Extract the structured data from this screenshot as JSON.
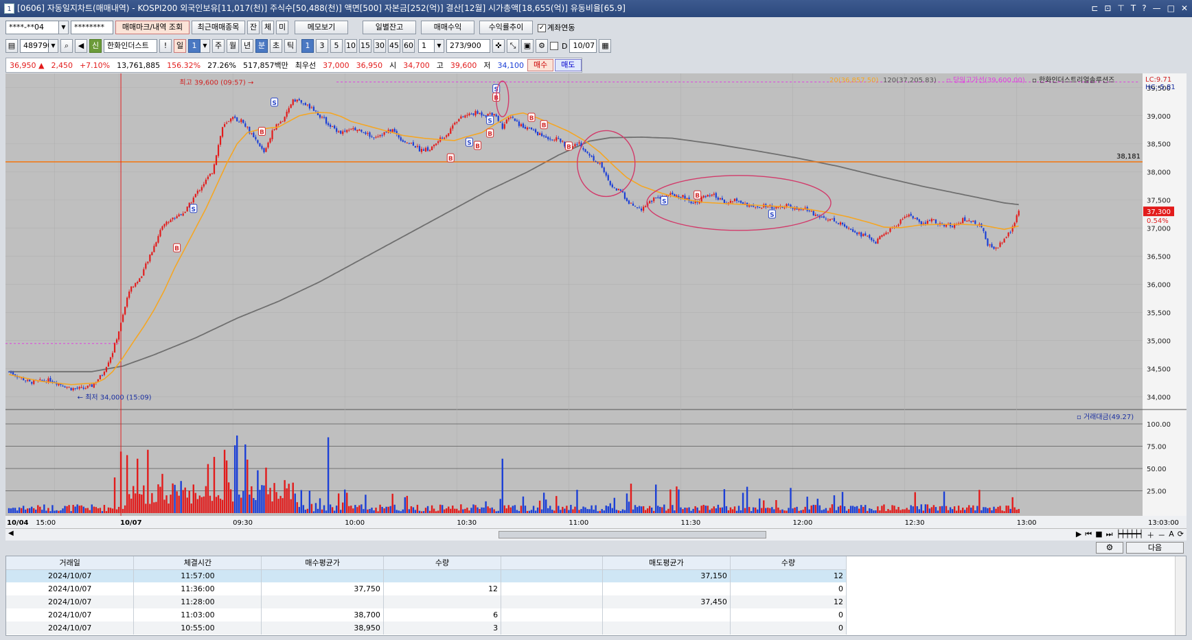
{
  "titlebar": {
    "badge": "1",
    "text": "[0606] 자동일지차트(매매내역) - KOSPI200 외국인보유[11,017(천)] 주식수[50,488(천)] 액면[500] 자본금[252(억)] 결산[12월] 시가총액[18,655(억)] 유동비율[65.9]",
    "controls": [
      "⊏",
      "⊡",
      "⊤",
      "T",
      "?",
      "—",
      "□",
      "✕"
    ]
  },
  "toolbar1": {
    "account": "****-**04",
    "password": "********",
    "btn_trade_mark": "매매마크/내역 조회",
    "btn_recent": "최근매매종목",
    "tab_jan": "잔",
    "tab_che": "체",
    "tab_mi": "미",
    "btn_memo": "메모보기",
    "btn_daily": "일별잔고",
    "btn_profit": "매매수익",
    "btn_rate": "수익률추이",
    "chk_link": "계좌연동"
  },
  "toolbar2": {
    "code": "489790",
    "stock_tag": "신",
    "stock_name": "한화인더스트",
    "excl": "!",
    "period": [
      "일",
      "1",
      "주",
      "월",
      "년",
      "분",
      "초",
      "틱"
    ],
    "minutes": [
      "1",
      "3",
      "5",
      "10",
      "15",
      "30",
      "45",
      "60"
    ],
    "step": "1",
    "count": "273",
    "count_total": "/900",
    "date_label": "D",
    "date": "10/07"
  },
  "quote": {
    "price": "36,950 ▲",
    "change": "2,450",
    "change_pct": "+7.10%",
    "volume": "13,761,885",
    "vol_ratio": "156.32%",
    "turnover": "27.26%",
    "amount": "517,857백만",
    "best_label": "최우선",
    "best_ask": "37,000",
    "best_bid": "36,950",
    "open_label": "시",
    "open": "34,700",
    "high_label": "고",
    "high": "39,600",
    "low_label": "저",
    "low": "34,100",
    "buy": "매수",
    "sell": "매도"
  },
  "chart_data": {
    "type": "candlestick",
    "legend": {
      "ma20": "20(36,857.50)",
      "ma120": "120(37,205.83)",
      "high_line": "당일고가선(39,600.00)",
      "name": "한화인더스트리얼솔루션즈",
      "lc": "LC:9.71",
      "hc": "HC:-5.81"
    },
    "price_axis": [
      "39,500",
      "39,000",
      "38,500",
      "38,000",
      "37,500",
      "37,000",
      "36,500",
      "36,000",
      "35,500",
      "35,000",
      "34,500",
      "34,000"
    ],
    "price_values": [
      39500,
      39000,
      38500,
      38000,
      37500,
      37000,
      36500,
      36000,
      35500,
      35000,
      34500,
      34000
    ],
    "ylim": [
      33850,
      39680
    ],
    "hline_value": 38181,
    "hline_label": "38,181",
    "current_label": "37,300",
    "current_value": 37300,
    "current_pct": "0.54%",
    "annotations": {
      "max": "최고 39,600 (09:57)",
      "min": "최저 34,000 (15:09)"
    },
    "volume_legend": "거래대금(49.27)",
    "volume_axis": [
      "100.00",
      "75.00",
      "50.00",
      "25.00"
    ],
    "volume_values": [
      100,
      75,
      50,
      25
    ],
    "time_axis": [
      "10/04",
      "15:00",
      "10/07",
      "09:30",
      "10:00",
      "10:30",
      "11:00",
      "11:30",
      "12:00",
      "12:30",
      "13:00"
    ],
    "time_end": "13:03:00",
    "anchors_price": [
      [
        0,
        34450
      ],
      [
        10,
        34260
      ],
      [
        20,
        34300
      ],
      [
        30,
        34150
      ],
      [
        36,
        34150
      ],
      [
        40,
        34200
      ],
      [
        45,
        34400
      ],
      [
        50,
        34800
      ],
      [
        54,
        35300
      ],
      [
        58,
        35900
      ],
      [
        63,
        36100
      ],
      [
        68,
        36500
      ],
      [
        74,
        37050
      ],
      [
        80,
        37200
      ],
      [
        85,
        37300
      ],
      [
        90,
        37600
      ],
      [
        98,
        38000
      ],
      [
        103,
        38800
      ],
      [
        108,
        38950
      ],
      [
        113,
        38900
      ],
      [
        118,
        38600
      ],
      [
        123,
        38350
      ],
      [
        128,
        38800
      ],
      [
        133,
        38950
      ],
      [
        137,
        39300
      ],
      [
        141,
        39250
      ],
      [
        146,
        39120
      ],
      [
        150,
        39000
      ],
      [
        155,
        38820
      ],
      [
        160,
        38700
      ],
      [
        165,
        38750
      ],
      [
        170,
        38750
      ],
      [
        175,
        38620
      ],
      [
        180,
        38680
      ],
      [
        185,
        38750
      ],
      [
        190,
        38550
      ],
      [
        195,
        38500
      ],
      [
        198,
        38400
      ],
      [
        203,
        38400
      ],
      [
        207,
        38550
      ],
      [
        212,
        38700
      ],
      [
        215,
        38900
      ],
      [
        220,
        39000
      ],
      [
        225,
        39050
      ],
      [
        230,
        39020
      ],
      [
        234,
        39050
      ],
      [
        238,
        38800
      ],
      [
        242,
        39000
      ],
      [
        246,
        38850
      ],
      [
        252,
        38750
      ],
      [
        258,
        38620
      ],
      [
        265,
        38580
      ],
      [
        270,
        38420
      ],
      [
        275,
        38520
      ],
      [
        280,
        38280
      ],
      [
        285,
        38160
      ],
      [
        290,
        37750
      ],
      [
        295,
        37650
      ],
      [
        300,
        37420
      ],
      [
        305,
        37350
      ],
      [
        310,
        37500
      ],
      [
        315,
        37550
      ],
      [
        320,
        37600
      ],
      [
        325,
        37560
      ],
      [
        330,
        37450
      ],
      [
        335,
        37550
      ],
      [
        340,
        37580
      ],
      [
        345,
        37450
      ],
      [
        350,
        37500
      ],
      [
        355,
        37440
      ],
      [
        360,
        37350
      ],
      [
        365,
        37400
      ],
      [
        370,
        37350
      ],
      [
        375,
        37400
      ],
      [
        380,
        37330
      ],
      [
        385,
        37340
      ],
      [
        390,
        37200
      ],
      [
        395,
        37180
      ],
      [
        400,
        37100
      ],
      [
        405,
        37020
      ],
      [
        410,
        36900
      ],
      [
        414,
        36850
      ],
      [
        418,
        36750
      ],
      [
        422,
        36900
      ],
      [
        428,
        37050
      ],
      [
        433,
        37250
      ],
      [
        436,
        37200
      ],
      [
        440,
        37050
      ],
      [
        445,
        37150
      ],
      [
        450,
        37050
      ],
      [
        455,
        37050
      ],
      [
        460,
        37150
      ],
      [
        465,
        37120
      ],
      [
        469,
        37020
      ],
      [
        472,
        36700
      ],
      [
        476,
        36650
      ],
      [
        480,
        36800
      ],
      [
        484,
        37000
      ],
      [
        487,
        37300
      ]
    ],
    "anchors_ma20": [
      [
        0,
        34400
      ],
      [
        15,
        34280
      ],
      [
        30,
        34220
      ],
      [
        42,
        34250
      ],
      [
        46,
        34320
      ],
      [
        50,
        34450
      ],
      [
        55,
        34700
      ],
      [
        60,
        34980
      ],
      [
        65,
        35250
      ],
      [
        70,
        35550
      ],
      [
        75,
        35900
      ],
      [
        80,
        36300
      ],
      [
        85,
        36650
      ],
      [
        90,
        37000
      ],
      [
        95,
        37350
      ],
      [
        100,
        37750
      ],
      [
        105,
        38150
      ],
      [
        110,
        38500
      ],
      [
        115,
        38700
      ],
      [
        120,
        38750
      ],
      [
        125,
        38780
      ],
      [
        130,
        38800
      ],
      [
        135,
        38900
      ],
      [
        140,
        39000
      ],
      [
        145,
        39040
      ],
      [
        150,
        39060
      ],
      [
        155,
        39050
      ],
      [
        160,
        38990
      ],
      [
        165,
        38900
      ],
      [
        170,
        38850
      ],
      [
        175,
        38800
      ],
      [
        180,
        38750
      ],
      [
        185,
        38700
      ],
      [
        190,
        38650
      ],
      [
        200,
        38600
      ],
      [
        210,
        38570
      ],
      [
        215,
        38560
      ],
      [
        220,
        38620
      ],
      [
        228,
        38700
      ],
      [
        235,
        38860
      ],
      [
        242,
        39010
      ],
      [
        248,
        39050
      ],
      [
        255,
        38960
      ],
      [
        262,
        38850
      ],
      [
        270,
        38720
      ],
      [
        278,
        38550
      ],
      [
        285,
        38350
      ],
      [
        292,
        38100
      ],
      [
        298,
        37900
      ],
      [
        305,
        37750
      ],
      [
        315,
        37620
      ],
      [
        325,
        37520
      ],
      [
        335,
        37460
      ],
      [
        345,
        37440
      ],
      [
        355,
        37420
      ],
      [
        365,
        37400
      ],
      [
        375,
        37380
      ],
      [
        385,
        37340
      ],
      [
        395,
        37280
      ],
      [
        405,
        37200
      ],
      [
        415,
        37100
      ],
      [
        422,
        37020
      ],
      [
        430,
        37010
      ],
      [
        440,
        37060
      ],
      [
        450,
        37070
      ],
      [
        460,
        37070
      ],
      [
        470,
        37050
      ],
      [
        480,
        36980
      ],
      [
        487,
        37040
      ]
    ],
    "anchors_ma120": [
      [
        0,
        34450
      ],
      [
        40,
        34450
      ],
      [
        55,
        34550
      ],
      [
        70,
        34750
      ],
      [
        90,
        35050
      ],
      [
        110,
        35400
      ],
      [
        130,
        35700
      ],
      [
        150,
        36050
      ],
      [
        170,
        36450
      ],
      [
        190,
        36850
      ],
      [
        210,
        37250
      ],
      [
        230,
        37650
      ],
      [
        250,
        38000
      ],
      [
        265,
        38300
      ],
      [
        280,
        38550
      ],
      [
        290,
        38610
      ],
      [
        305,
        38620
      ],
      [
        320,
        38600
      ],
      [
        340,
        38500
      ],
      [
        360,
        38380
      ],
      [
        380,
        38250
      ],
      [
        400,
        38100
      ],
      [
        420,
        37920
      ],
      [
        440,
        37750
      ],
      [
        460,
        37600
      ],
      [
        480,
        37450
      ],
      [
        487,
        37420
      ]
    ],
    "trade_marks": [
      {
        "type": "S",
        "idx": 128,
        "price": 39230
      },
      {
        "type": "B",
        "idx": 122,
        "price": 38710
      },
      {
        "type": "S",
        "idx": 89,
        "price": 37340
      },
      {
        "type": "B",
        "idx": 81,
        "price": 36640
      },
      {
        "type": "S",
        "idx": 235,
        "price": 39470
      },
      {
        "type": "B",
        "idx": 235,
        "price": 39320
      },
      {
        "type": "S",
        "idx": 232,
        "price": 38910
      },
      {
        "type": "B",
        "idx": 232,
        "price": 38680
      },
      {
        "type": "S",
        "idx": 222,
        "price": 38520
      },
      {
        "type": "B",
        "idx": 226,
        "price": 38460
      },
      {
        "type": "B",
        "idx": 213,
        "price": 38240
      },
      {
        "type": "B",
        "idx": 252,
        "price": 38960
      },
      {
        "type": "B",
        "idx": 258,
        "price": 38830
      },
      {
        "type": "B",
        "idx": 270,
        "price": 38450
      },
      {
        "type": "S",
        "idx": 316,
        "price": 37480
      },
      {
        "type": "B",
        "idx": 332,
        "price": 37580
      },
      {
        "type": "S",
        "idx": 368,
        "price": 37240
      }
    ],
    "vol_spikes": [
      [
        51,
        40
      ],
      [
        54,
        69
      ],
      [
        57,
        65
      ],
      [
        62,
        61
      ],
      [
        67,
        71
      ],
      [
        74,
        44
      ],
      [
        83,
        36
      ],
      [
        96,
        55
      ],
      [
        99,
        63
      ],
      [
        104,
        71
      ],
      [
        105,
        59
      ],
      [
        109,
        76
      ],
      [
        110,
        87
      ],
      [
        114,
        77
      ],
      [
        115,
        60
      ],
      [
        120,
        48
      ],
      [
        124,
        51
      ],
      [
        133,
        37
      ],
      [
        154,
        85
      ],
      [
        159,
        22
      ],
      [
        238,
        61
      ],
      [
        300,
        33
      ],
      [
        312,
        32
      ]
    ]
  },
  "grid": {
    "headers": [
      "거래일",
      "체결시간",
      "매수평균가",
      "수량",
      "",
      "매도평균가",
      "수량"
    ],
    "rows": [
      [
        "2024/10/07",
        "11:57:00",
        "",
        "",
        "",
        "37,150",
        "12"
      ],
      [
        "2024/10/07",
        "11:36:00",
        "37,750",
        "12",
        "",
        "",
        "0"
      ],
      [
        "2024/10/07",
        "11:28:00",
        "",
        "",
        "",
        "37,450",
        "12"
      ],
      [
        "2024/10/07",
        "11:03:00",
        "38,700",
        "6",
        "",
        "",
        "0"
      ],
      [
        "2024/10/07",
        "10:55:00",
        "38,950",
        "3",
        "",
        "",
        "0"
      ]
    ],
    "next": "다음"
  },
  "colors": {
    "up": "#e21b1b",
    "down": "#1b3fd6",
    "ma20": "#f5a623",
    "ma120": "#6f6f6f",
    "hline": "#f07a1a",
    "marker": "#d23a6a"
  }
}
